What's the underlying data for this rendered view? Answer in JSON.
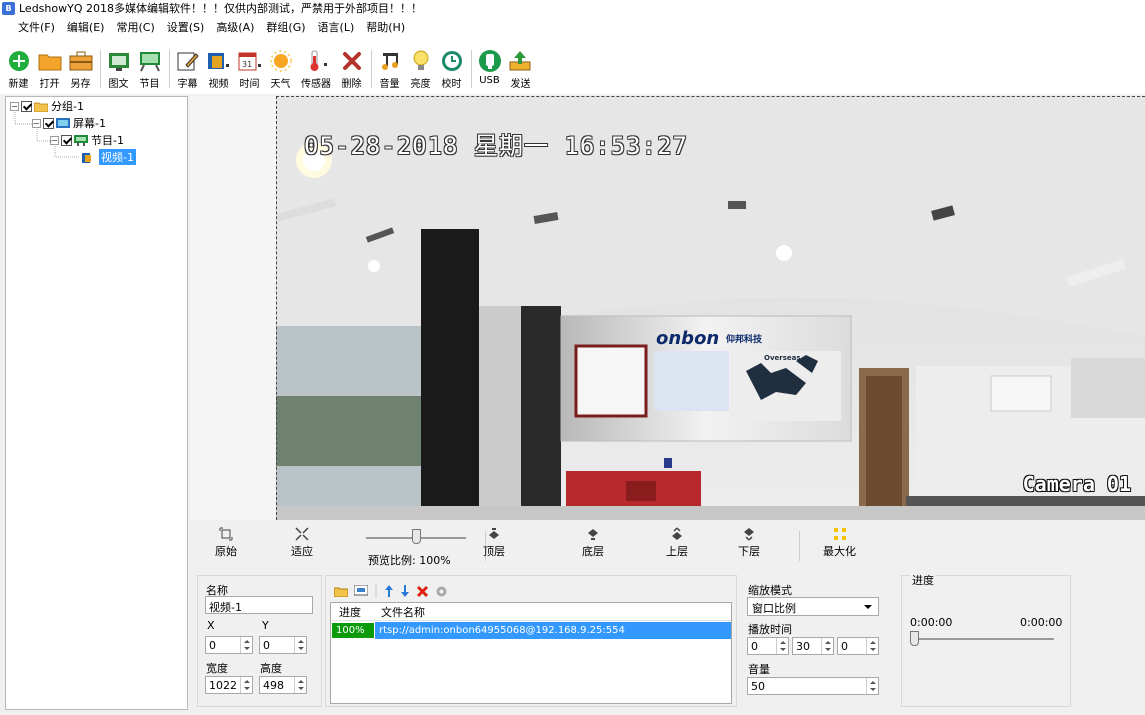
{
  "window": {
    "icon_text": "B",
    "title": "LedshowYQ 2018多媒体编辑软件！！！仅供内部测试，严禁用于外部项目！！！"
  },
  "menu": [
    "文件(F)",
    "编辑(E)",
    "常用(C)",
    "设置(S)",
    "高级(A)",
    "群组(G)",
    "语言(L)",
    "帮助(H)"
  ],
  "toolbar": {
    "new": "新建",
    "open": "打开",
    "saveas": "另存",
    "image_text": "图文",
    "program": "节目",
    "subtitle": "字幕",
    "video": "视频",
    "time": "时间",
    "weather": "天气",
    "sensor": "传感器",
    "delete": "删除",
    "volume": "音量",
    "brightness": "亮度",
    "timecheck": "校时",
    "usb": "USB",
    "send": "发送"
  },
  "tree": {
    "group": "分组-1",
    "screen": "屏幕-1",
    "program": "节目-1",
    "video": "视频-1"
  },
  "preview": {
    "osd_time": "05-28-2018 星期一 16:53:27",
    "camera_label": "Camera 01",
    "wall_logo": "onbon",
    "wall_logo_sub": "仰邦科技",
    "wall_text": "Overseas"
  },
  "viewbar": {
    "original": "原始",
    "fit": "适应",
    "zoom_label": "预览比例: 100%",
    "zoom_value": 100,
    "top_layer": "顶层",
    "bottom_layer": "底层",
    "up_layer": "上层",
    "down_layer": "下层",
    "maximize": "最大化"
  },
  "props": {
    "name_label": "名称",
    "name_value": "视频-1",
    "x_label": "X",
    "y_label": "Y",
    "x_value": "0",
    "y_value": "0",
    "width_label": "宽度",
    "height_label": "高度",
    "width_value": "1022",
    "height_value": "498"
  },
  "files": {
    "col_progress": "进度",
    "col_filename": "文件名称",
    "rows": [
      {
        "progress": "100%",
        "name": "rtsp://admin:onbon64955068@192.168.9.25:554"
      }
    ]
  },
  "zoom_mode": {
    "label": "缩放模式",
    "selected": "窗口比例",
    "play_time_label": "播放时间",
    "play_h": "0",
    "play_m": "30",
    "play_s": "0",
    "volume_label": "音量",
    "volume_value": "50"
  },
  "progress_panel": {
    "label": "进度",
    "time_current": "0:00:00",
    "time_total": "0:00:00",
    "position": 0
  }
}
